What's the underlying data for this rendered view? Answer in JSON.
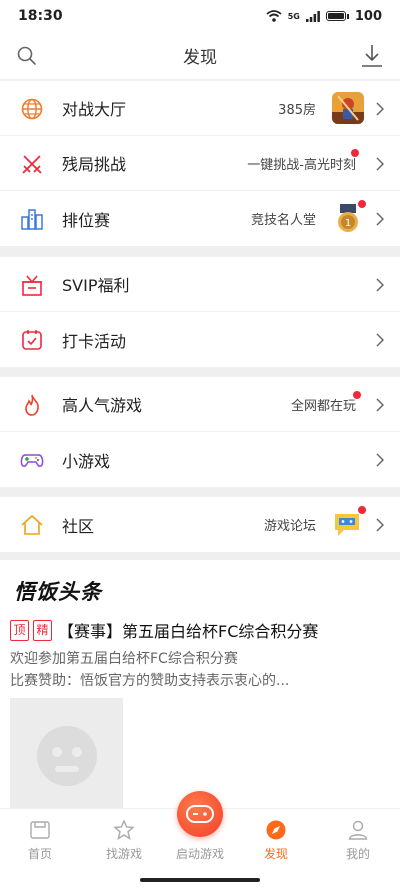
{
  "status": {
    "time": "18:30",
    "battery": "100",
    "net": "5G"
  },
  "header": {
    "title": "发现"
  },
  "group1": [
    {
      "label": "对战大厅",
      "sub": "385房"
    },
    {
      "label": "残局挑战",
      "sub": "一键挑战-高光时刻"
    },
    {
      "label": "排位赛",
      "sub": "竞技名人堂"
    }
  ],
  "group2": [
    {
      "label": "SVIP福利"
    },
    {
      "label": "打卡活动"
    }
  ],
  "group3": [
    {
      "label": "高人气游戏",
      "sub": "全网都在玩"
    },
    {
      "label": "小游戏"
    }
  ],
  "group4": [
    {
      "label": "社区",
      "sub": "游戏论坛"
    }
  ],
  "news": {
    "logo": "悟饭头条",
    "tag_top": "顶",
    "tag_elite": "精",
    "title": "【赛事】第五届白给杯FC综合积分赛",
    "desc_line1": "欢迎参加第五届白给杯FC综合积分赛",
    "desc_line2": "比赛赞助：悟饭官方的赞助支持表示衷心的..."
  },
  "tabs": [
    {
      "label": "首页"
    },
    {
      "label": "找游戏"
    },
    {
      "label": "启动游戏"
    },
    {
      "label": "发现"
    },
    {
      "label": "我的"
    }
  ],
  "colors": {
    "accent": "#ff6a1a",
    "badge": "#f0283c"
  },
  "icons": [
    "search-icon",
    "download-icon",
    "globe-icon",
    "crossed-swords-icon",
    "buildings-icon",
    "gift-icon",
    "calendar-check-icon",
    "flame-icon",
    "gamepad-icon",
    "house-icon",
    "chevron-right-icon"
  ]
}
